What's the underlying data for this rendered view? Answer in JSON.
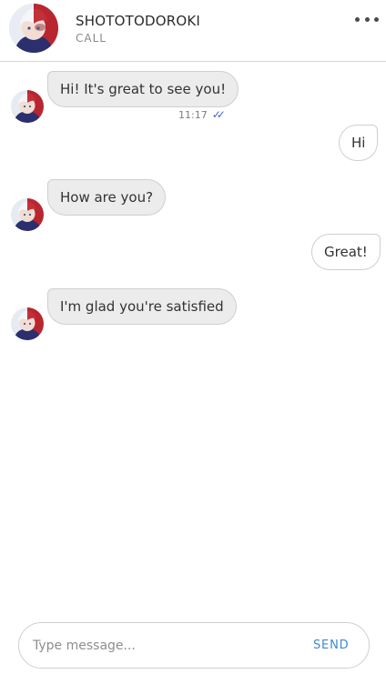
{
  "header": {
    "contact_name": "SHOTOTODOROKI",
    "call_label": "CALL",
    "menu_icon": "more-dots-icon"
  },
  "messages": [
    {
      "direction": "incoming",
      "text": "Hi! It's great to see you!",
      "time": "11:17",
      "status_icon": "double-check-icon"
    },
    {
      "direction": "outgoing",
      "text": "Hi"
    },
    {
      "direction": "incoming",
      "text": "How are you?"
    },
    {
      "direction": "outgoing",
      "text": "Great!"
    },
    {
      "direction": "incoming",
      "text": "I'm glad you're satisfied"
    }
  ],
  "composer": {
    "placeholder": "Type message...",
    "send_label": "SEND"
  },
  "colors": {
    "accent": "#3e88cf",
    "read_check": "#4a63c9",
    "incoming_bubble": "#ececec",
    "outgoing_bubble": "#ffffff",
    "border": "#cfcfcf"
  }
}
